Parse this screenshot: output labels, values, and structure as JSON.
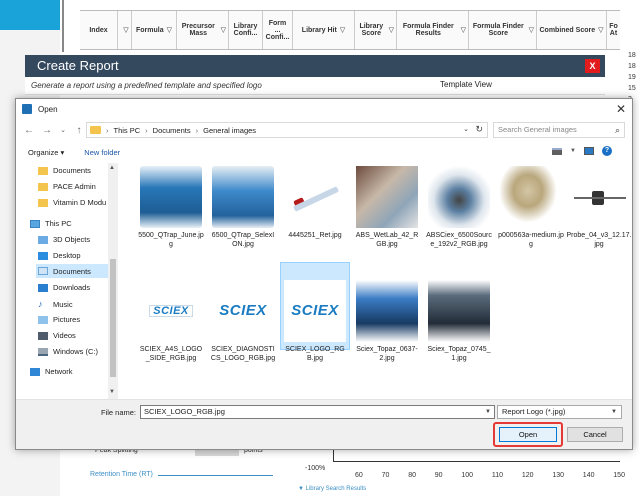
{
  "background_app": {
    "grid_headers": [
      {
        "label": "Index",
        "filter": false
      },
      {
        "label": "",
        "filter": true
      },
      {
        "label": "Formula",
        "filter": true
      },
      {
        "label": "Precursor Mass",
        "filter": true
      },
      {
        "label": "Library Confi...",
        "filter": true
      },
      {
        "label": "Form ... Confi...",
        "filter": true
      },
      {
        "label": "Library Hit",
        "filter": true
      },
      {
        "label": "Library Score",
        "filter": true
      },
      {
        "label": "Formula Finder Results",
        "filter": true
      },
      {
        "label": "Formula Finder Score",
        "filter": true
      },
      {
        "label": "Combined Score",
        "filter": true
      },
      {
        "label": "Fo At",
        "filter": false
      }
    ],
    "filter_icon": "▽",
    "right_numbers": [
      "18",
      "18",
      "19",
      "15",
      "3",
      "4",
      "1",
      "1",
      "0",
      "8",
      "4",
      "2",
      "3",
      "1",
      "1",
      "8"
    ],
    "create_report": {
      "title": "Create Report",
      "close_label": "X",
      "description": "Generate a report using a predefined template and specified logo",
      "template_view_label": "Template View"
    },
    "peak_splitting_label": "Peak Splitting",
    "points_label": "points",
    "retention_time_label": "Retention Time (RT)",
    "axis_label": "-100%",
    "axis_ticks": [
      "60",
      "70",
      "80",
      "90",
      "100",
      "110",
      "120",
      "130",
      "140",
      "150"
    ],
    "library_results_label": "▼ Library Search Results"
  },
  "dialog": {
    "title": "Open",
    "close_glyph": "✕",
    "nav": {
      "back": "←",
      "forward": "→",
      "recent": "⌄",
      "up": "↑",
      "breadcrumb": [
        "This PC",
        "Documents",
        "General images"
      ],
      "breadcrumb_sep": "›",
      "dropdown": "⌄",
      "refresh": "↻"
    },
    "search": {
      "placeholder": "Search General images",
      "icon": "⌕"
    },
    "toolbar": {
      "organize_label": "Organize ▾",
      "new_folder_label": "New folder"
    },
    "help_label": "?",
    "nav_pane": [
      {
        "label": "Documents",
        "icon": "folder-icon"
      },
      {
        "label": "PACE Admin",
        "icon": "folder-icon"
      },
      {
        "label": "Vitamin D Modu",
        "icon": "folder-icon"
      },
      {
        "label": "This PC",
        "icon": "this-pc-icon"
      },
      {
        "label": "3D Objects",
        "icon": "3d-objects-icon"
      },
      {
        "label": "Desktop",
        "icon": "desktop-icon"
      },
      {
        "label": "Documents",
        "icon": "documents-icon",
        "selected": true
      },
      {
        "label": "Downloads",
        "icon": "downloads-icon"
      },
      {
        "label": "Music",
        "icon": "music-icon"
      },
      {
        "label": "Pictures",
        "icon": "pictures-icon"
      },
      {
        "label": "Videos",
        "icon": "videos-icon"
      },
      {
        "label": "Windows (C:)",
        "icon": "drive-icon"
      },
      {
        "label": "Network",
        "icon": "network-icon"
      }
    ],
    "files": [
      {
        "name": "5500_QTrap_June.jpg"
      },
      {
        "name": "6500_QTrap_SelexION.jpg"
      },
      {
        "name": "4445251_Ret.jpg"
      },
      {
        "name": "ABS_WetLab_42_RGB.jpg"
      },
      {
        "name": "ABSCiex_6500Source_192v2_RGB.jpg"
      },
      {
        "name": "p000563a-medium.jpg"
      },
      {
        "name": "Probe_04_v3_12.17.jpg"
      },
      {
        "name": "SCIEX_A4S_LOGO_SIDE_RGB.jpg"
      },
      {
        "name": "SCIEX_DIAGNOSTICS_LOGO_RGB.jpg"
      },
      {
        "name": "SCIEX_LOGO_RGB.jpg",
        "selected": true
      },
      {
        "name": "Sciex_Topaz_0637-2.jpg"
      },
      {
        "name": "Sciex_Topaz_0745_1.jpg"
      }
    ],
    "logo_text": "SCIEX",
    "file_name_label": "File name:",
    "file_name_value": "SCIEX_LOGO_RGB.jpg",
    "file_type": "Report Logo (*.jpg)",
    "open_label": "Open",
    "cancel_label": "Cancel",
    "colors": {
      "accent": "#0078d7",
      "highlight": "#e53935",
      "selection": "#cce8ff",
      "title_bar": "#34495e"
    }
  }
}
